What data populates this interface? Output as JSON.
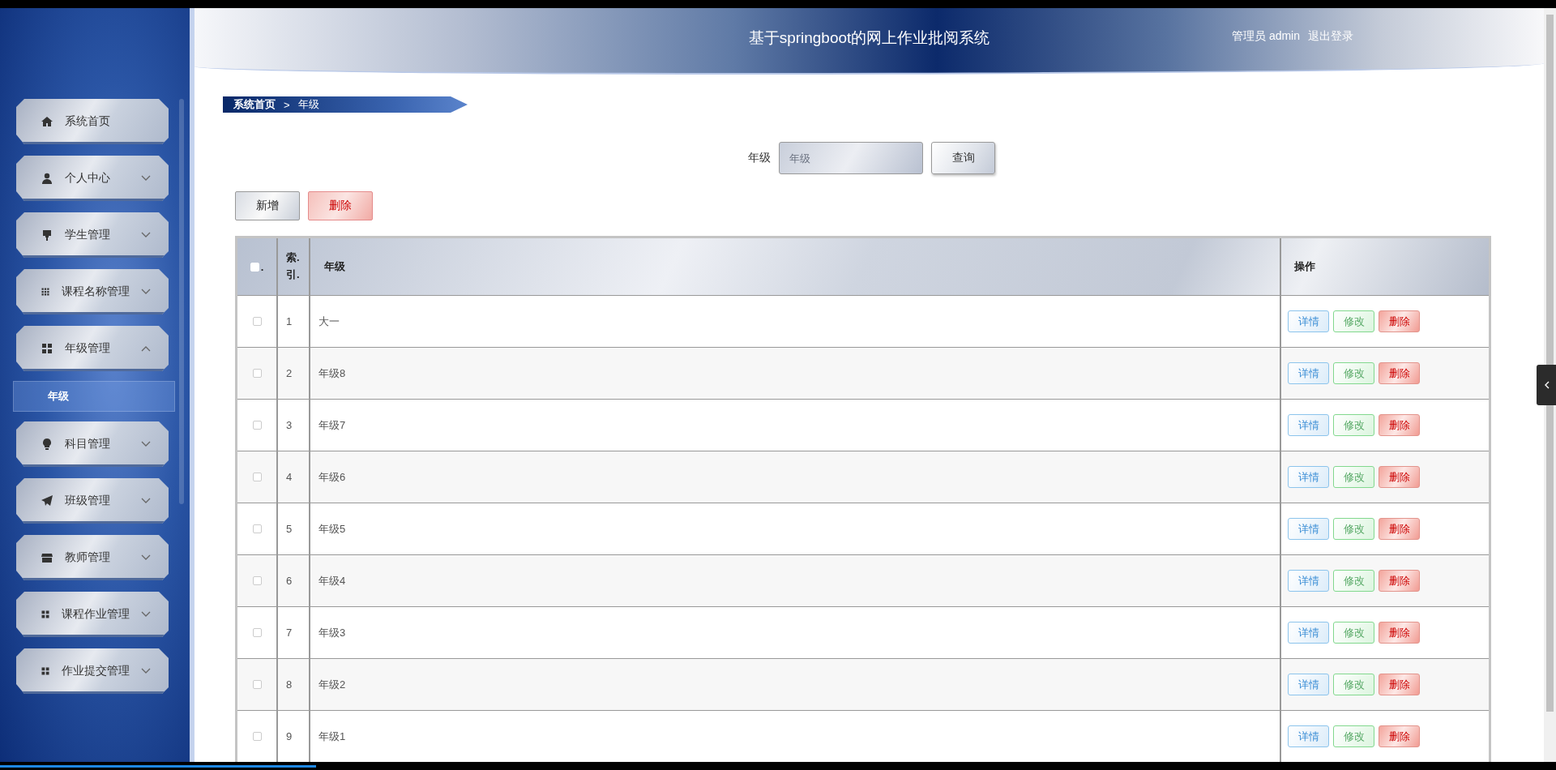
{
  "header": {
    "title": "基于springboot的网上作业批阅系统",
    "user": "管理员 admin",
    "logout": "退出登录"
  },
  "sidebar": {
    "items": [
      {
        "label": "系统首页",
        "kind": "link"
      },
      {
        "label": "个人中心",
        "kind": "menu",
        "expanded": false
      },
      {
        "label": "学生管理",
        "kind": "menu",
        "expanded": false
      },
      {
        "label": "课程名称管理",
        "kind": "menu",
        "expanded": false
      },
      {
        "label": "年级管理",
        "kind": "menu",
        "expanded": true,
        "children": [
          {
            "label": "年级",
            "selected": true
          }
        ]
      },
      {
        "label": "科目管理",
        "kind": "menu",
        "expanded": false
      },
      {
        "label": "班级管理",
        "kind": "menu",
        "expanded": false
      },
      {
        "label": "教师管理",
        "kind": "menu",
        "expanded": false
      },
      {
        "label": "课程作业管理",
        "kind": "menu",
        "expanded": false
      },
      {
        "label": "作业提交管理",
        "kind": "menu",
        "expanded": false
      }
    ]
  },
  "breadcrumb": {
    "items": [
      "系统首页",
      "年级"
    ],
    "separator": ">"
  },
  "search": {
    "label": "年级",
    "placeholder": "年级",
    "button": "查询"
  },
  "actions": [
    {
      "label": "新增",
      "kind": "default"
    },
    {
      "label": "删除",
      "kind": "danger"
    }
  ],
  "table": {
    "columns": [
      {
        "kind": "checkbox",
        "label": ".",
        "checked": false
      },
      {
        "kind": "index",
        "label": "索.\n引."
      },
      {
        "kind": "text",
        "label": "年级"
      },
      {
        "kind": "actions",
        "label": "操作"
      }
    ],
    "rows": [
      {
        "checked": false,
        "index": "1",
        "grade": "大一",
        "actions": [
          {
            "label": "详情",
            "kind": "info"
          },
          {
            "label": "修改",
            "kind": "edit"
          },
          {
            "label": "删除",
            "kind": "delete"
          }
        ]
      },
      {
        "checked": false,
        "index": "2",
        "grade": "年级8",
        "actions": [
          {
            "label": "详情",
            "kind": "info"
          },
          {
            "label": "修改",
            "kind": "edit"
          },
          {
            "label": "删除",
            "kind": "delete"
          }
        ]
      },
      {
        "checked": false,
        "index": "3",
        "grade": "年级7",
        "actions": [
          {
            "label": "详情",
            "kind": "info"
          },
          {
            "label": "修改",
            "kind": "edit"
          },
          {
            "label": "删除",
            "kind": "delete"
          }
        ]
      },
      {
        "checked": false,
        "index": "4",
        "grade": "年级6",
        "actions": [
          {
            "label": "详情",
            "kind": "info"
          },
          {
            "label": "修改",
            "kind": "edit"
          },
          {
            "label": "删除",
            "kind": "delete"
          }
        ]
      },
      {
        "checked": false,
        "index": "5",
        "grade": "年级5",
        "actions": [
          {
            "label": "详情",
            "kind": "info"
          },
          {
            "label": "修改",
            "kind": "edit"
          },
          {
            "label": "删除",
            "kind": "delete"
          }
        ]
      },
      {
        "checked": false,
        "index": "6",
        "grade": "年级4",
        "actions": [
          {
            "label": "详情",
            "kind": "info"
          },
          {
            "label": "修改",
            "kind": "edit"
          },
          {
            "label": "删除",
            "kind": "delete"
          }
        ]
      },
      {
        "checked": false,
        "index": "7",
        "grade": "年级3",
        "actions": [
          {
            "label": "详情",
            "kind": "info"
          },
          {
            "label": "修改",
            "kind": "edit"
          },
          {
            "label": "删除",
            "kind": "delete"
          }
        ]
      },
      {
        "checked": false,
        "index": "8",
        "grade": "年级2",
        "actions": [
          {
            "label": "详情",
            "kind": "info"
          },
          {
            "label": "修改",
            "kind": "edit"
          },
          {
            "label": "删除",
            "kind": "delete"
          }
        ]
      },
      {
        "checked": false,
        "index": "9",
        "grade": "年级1",
        "actions": [
          {
            "label": "详情",
            "kind": "info"
          },
          {
            "label": "修改",
            "kind": "edit"
          },
          {
            "label": "删除",
            "kind": "delete"
          }
        ]
      }
    ]
  }
}
